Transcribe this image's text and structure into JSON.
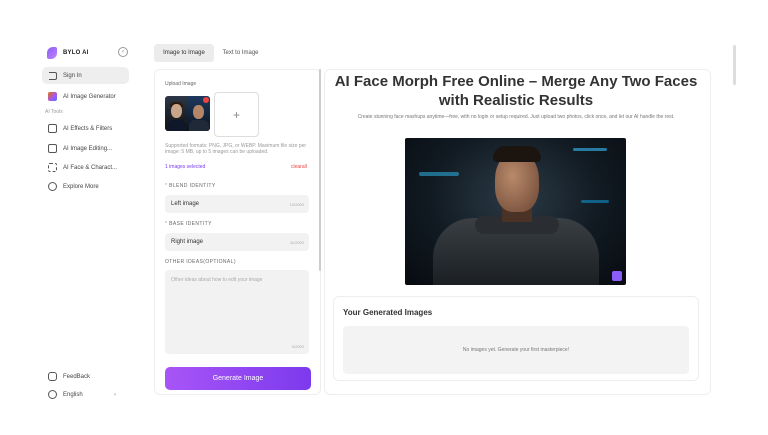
{
  "sidebar": {
    "brand": "BYLO AI",
    "collapse_icon": "‹",
    "signin": "Sign In",
    "image_generator": "AI Image Generator",
    "section_title": "AI Tools",
    "items": [
      {
        "label": "AI Effects & Filters"
      },
      {
        "label": "AI Image Editing..."
      },
      {
        "label": "AI Face & Charact..."
      },
      {
        "label": "Explore More"
      }
    ],
    "feedback": "FeedBack",
    "language": "English",
    "language_arrow": "›"
  },
  "tabs": {
    "active": "Image to Image",
    "inactive": "Text to Image"
  },
  "form": {
    "upload_label": "Upload Image",
    "add_icon": "+",
    "hint": "Supported formats: PNG, JPG, or WEBP. Maximum file size per image: 5 MB, up to 5 images can be uploaded.",
    "selected": "1 images selected",
    "clear": "clearall",
    "blend_label": "BLEND IDENTITY",
    "blend_value": "Left image",
    "blend_count": "10/2000",
    "base_label": "BASE IDENTITY",
    "base_value": "Right image",
    "base_count": "11/2000",
    "other_label": "OTHER IDEAS(OPTIONAL)",
    "other_placeholder": "Other ideas about how to edit your image",
    "other_count": "0/2000",
    "generate": "Generate Image"
  },
  "main": {
    "title": "AI Face Morph Free Online – Merge Any Two Faces with Realistic Results",
    "subtitle": "Create stunning face mashups anytime—free, with no login or setup required. Just upload two photos, click once, and let our AI handle the rest.",
    "generated_title": "Your Generated Images",
    "empty_text": "No images yet. Generate your first masterpiece!"
  },
  "colors": {
    "accent": "#8b5cf6",
    "button_start": "#a855f7",
    "button_end": "#7c3aed",
    "clear": "#ef4444"
  }
}
